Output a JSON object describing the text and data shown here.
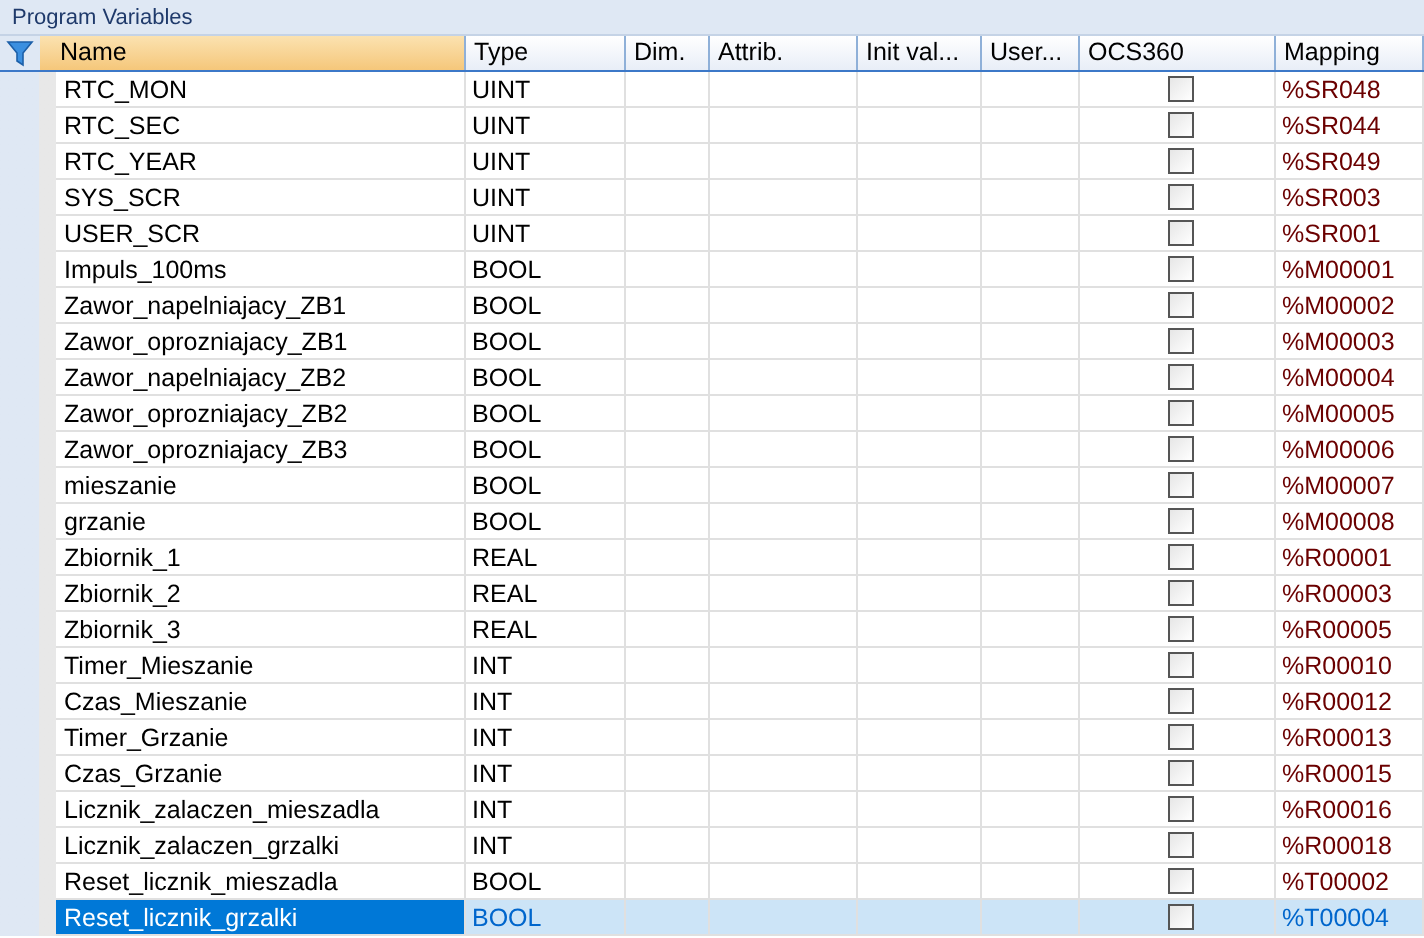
{
  "panel": {
    "title": "Program Variables"
  },
  "table": {
    "columns": [
      "Name",
      "Type",
      "Dim.",
      "Attrib.",
      "Init val...",
      "User...",
      "OCS360",
      "Mapping"
    ],
    "rows": [
      {
        "name": "RTC_MON",
        "type": "UINT",
        "ocs360": false,
        "mapping": "%SR048",
        "selected": false
      },
      {
        "name": "RTC_SEC",
        "type": "UINT",
        "ocs360": false,
        "mapping": "%SR044",
        "selected": false
      },
      {
        "name": "RTC_YEAR",
        "type": "UINT",
        "ocs360": false,
        "mapping": "%SR049",
        "selected": false
      },
      {
        "name": "SYS_SCR",
        "type": "UINT",
        "ocs360": false,
        "mapping": "%SR003",
        "selected": false
      },
      {
        "name": "USER_SCR",
        "type": "UINT",
        "ocs360": false,
        "mapping": "%SR001",
        "selected": false
      },
      {
        "name": "Impuls_100ms",
        "type": "BOOL",
        "ocs360": false,
        "mapping": "%M00001",
        "selected": false
      },
      {
        "name": "Zawor_napelniajacy_ZB1",
        "type": "BOOL",
        "ocs360": false,
        "mapping": "%M00002",
        "selected": false
      },
      {
        "name": "Zawor_oprozniajacy_ZB1",
        "type": "BOOL",
        "ocs360": false,
        "mapping": "%M00003",
        "selected": false
      },
      {
        "name": "Zawor_napelniajacy_ZB2",
        "type": "BOOL",
        "ocs360": false,
        "mapping": "%M00004",
        "selected": false
      },
      {
        "name": "Zawor_oprozniajacy_ZB2",
        "type": "BOOL",
        "ocs360": false,
        "mapping": "%M00005",
        "selected": false
      },
      {
        "name": "Zawor_oprozniajacy_ZB3",
        "type": "BOOL",
        "ocs360": false,
        "mapping": "%M00006",
        "selected": false
      },
      {
        "name": "mieszanie",
        "type": "BOOL",
        "ocs360": false,
        "mapping": "%M00007",
        "selected": false
      },
      {
        "name": "grzanie",
        "type": "BOOL",
        "ocs360": false,
        "mapping": "%M00008",
        "selected": false
      },
      {
        "name": "Zbiornik_1",
        "type": "REAL",
        "ocs360": false,
        "mapping": "%R00001",
        "selected": false
      },
      {
        "name": "Zbiornik_2",
        "type": "REAL",
        "ocs360": false,
        "mapping": "%R00003",
        "selected": false
      },
      {
        "name": "Zbiornik_3",
        "type": "REAL",
        "ocs360": false,
        "mapping": "%R00005",
        "selected": false
      },
      {
        "name": "Timer_Mieszanie",
        "type": "INT",
        "ocs360": false,
        "mapping": "%R00010",
        "selected": false
      },
      {
        "name": "Czas_Mieszanie",
        "type": "INT",
        "ocs360": false,
        "mapping": "%R00012",
        "selected": false
      },
      {
        "name": "Timer_Grzanie",
        "type": "INT",
        "ocs360": false,
        "mapping": "%R00013",
        "selected": false
      },
      {
        "name": "Czas_Grzanie",
        "type": "INT",
        "ocs360": false,
        "mapping": "%R00015",
        "selected": false
      },
      {
        "name": "Licznik_zalaczen_mieszadla",
        "type": "INT",
        "ocs360": false,
        "mapping": "%R00016",
        "selected": false
      },
      {
        "name": "Licznik_zalaczen_grzalki",
        "type": "INT",
        "ocs360": false,
        "mapping": "%R00018",
        "selected": false
      },
      {
        "name": "Reset_licznik_mieszadla",
        "type": "BOOL",
        "ocs360": false,
        "mapping": "%T00002",
        "selected": false
      },
      {
        "name": "Reset_licznik_grzalki",
        "type": "BOOL",
        "ocs360": false,
        "mapping": "%T00004",
        "selected": true
      }
    ]
  }
}
